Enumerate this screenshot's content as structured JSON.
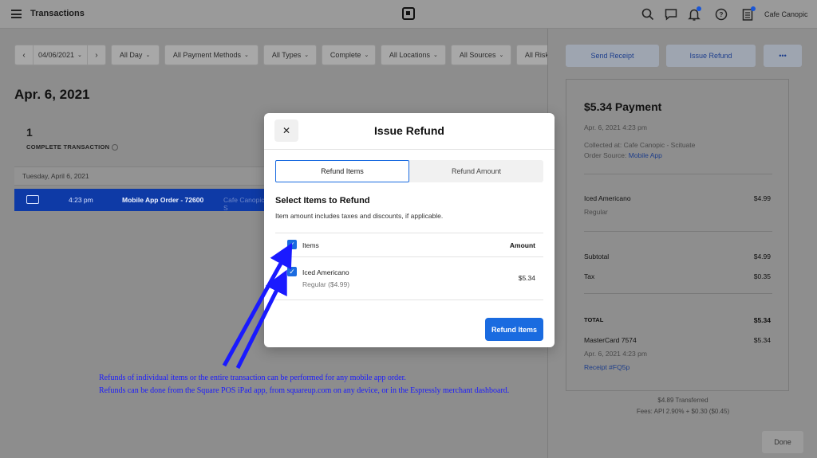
{
  "topbar": {
    "app_title": "Transactions",
    "store_name": "Cafe Canopic",
    "icons": [
      "menu-icon",
      "square-logo-icon",
      "search-icon",
      "chat-icon",
      "bell-icon",
      "help-icon",
      "register-icon"
    ]
  },
  "filters": {
    "prev": "‹",
    "date": "04/06/2021",
    "next": "›",
    "items": [
      {
        "label": "All Day"
      },
      {
        "label": "All Payment Methods"
      },
      {
        "label": "All Types"
      },
      {
        "label": "Complete"
      },
      {
        "label": "All Locations"
      },
      {
        "label": "All Sources"
      },
      {
        "label": "All Risk Le"
      }
    ]
  },
  "page": {
    "date_title": "Apr. 6, 2021",
    "count": "1",
    "count_label": "COMPLETE TRANSACTION",
    "group_header": "Tuesday, April 6, 2021",
    "transaction": {
      "time": "4:23 pm",
      "description": "Mobile App Order - 72600",
      "location": "Cafe Canopic - S"
    }
  },
  "right_panel": {
    "buttons": {
      "send_receipt": "Send Receipt",
      "issue_refund": "Issue Refund",
      "more": "•••"
    },
    "receipt": {
      "title": "$5.34 Payment",
      "datetime": "Apr. 6, 2021 4:23 pm",
      "collected_at_label": "Collected at: Cafe Canopic - Scituate",
      "order_source_label": "Order Source:",
      "order_source_value": "Mobile App",
      "item_name": "Iced Americano",
      "item_variant": "Regular",
      "item_price": "$4.99",
      "subtotal_label": "Subtotal",
      "subtotal_value": "$4.99",
      "tax_label": "Tax",
      "tax_value": "$0.35",
      "total_label": "TOTAL",
      "total_value": "$5.34",
      "card_label": "MasterCard 7574",
      "card_value": "$5.34",
      "card_datetime": "Apr. 6, 2021 4:23 pm",
      "receipt_link": "Receipt #FQ5p"
    },
    "transferred": "$4.89 Transferred",
    "fees": "Fees: API 2.90% + $0.30 ($0.45)",
    "done": "Done"
  },
  "modal": {
    "close": "✕",
    "title": "Issue Refund",
    "tabs": {
      "items": "Refund Items",
      "amount": "Refund Amount"
    },
    "section_title": "Select Items to Refund",
    "section_subtitle": "Item amount includes taxes and discounts, if applicable.",
    "header_items": "Items",
    "header_amount": "Amount",
    "item_name": "Iced Americano",
    "item_detail": "Regular ($4.99)",
    "item_amount": "$5.34",
    "refund_button": "Refund Items",
    "checkbox_checked": true
  },
  "annotation": {
    "line1": "Refunds of individual items or the entire transaction can be performed for any mobile app order.",
    "line2": "Refunds can be done from the Square POS iPad app, from squareup.com on any device, or in the Espressly merchant dashboard.",
    "color": "#1a1aff"
  },
  "colors": {
    "accent": "#1a6be0",
    "selected_row": "#0e3aa6",
    "annotation": "#1a1aff"
  }
}
